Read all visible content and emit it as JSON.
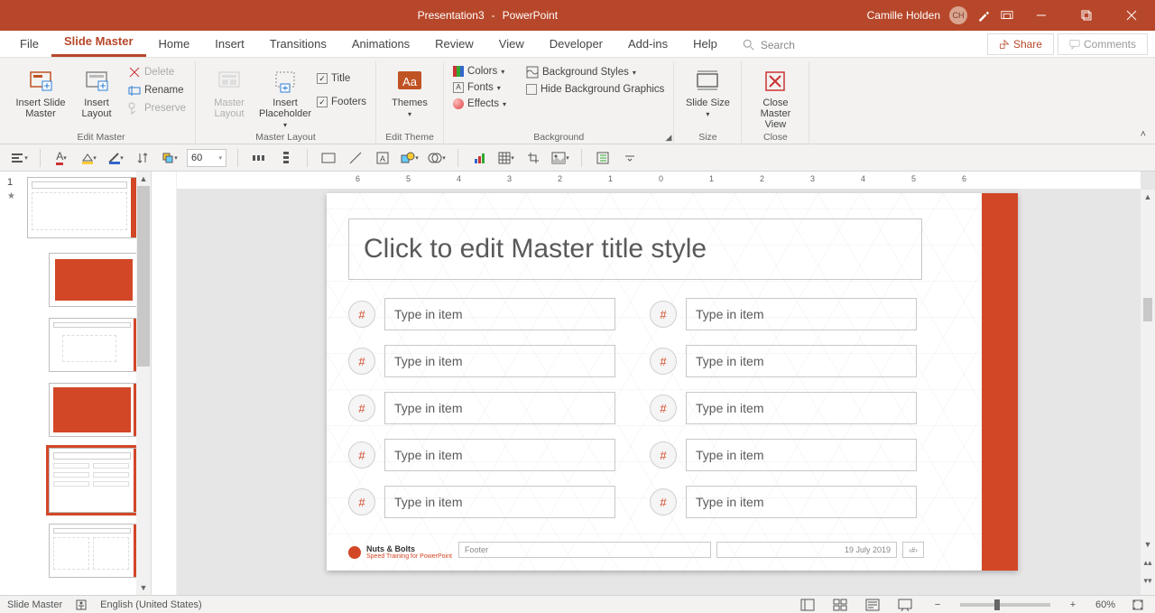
{
  "titlebar": {
    "doc": "Presentation3",
    "sep": "-",
    "app": "PowerPoint",
    "user": "Camille Holden",
    "initials": "CH"
  },
  "tabs": {
    "file": "File",
    "slide_master": "Slide Master",
    "home": "Home",
    "insert": "Insert",
    "transitions": "Transitions",
    "animations": "Animations",
    "review": "Review",
    "view": "View",
    "developer": "Developer",
    "addins": "Add-ins",
    "help": "Help",
    "search": "Search",
    "share": "Share",
    "comments": "Comments"
  },
  "ribbon": {
    "edit_master": {
      "insert_slide_master": "Insert Slide Master",
      "insert_layout": "Insert Layout",
      "delete": "Delete",
      "rename": "Rename",
      "preserve": "Preserve",
      "group": "Edit Master"
    },
    "master_layout": {
      "master_layout": "Master Layout",
      "insert_placeholder": "Insert Placeholder",
      "title_cb": "Title",
      "footers_cb": "Footers",
      "group": "Master Layout"
    },
    "edit_theme": {
      "themes": "Themes",
      "group": "Edit Theme"
    },
    "background": {
      "colors": "Colors",
      "fonts": "Fonts",
      "effects": "Effects",
      "bg_styles": "Background Styles",
      "hide_bg": "Hide Background Graphics",
      "group": "Background"
    },
    "size": {
      "slide_size": "Slide Size",
      "group": "Size"
    },
    "close": {
      "close_master": "Close Master View",
      "group": "Close"
    }
  },
  "qat": {
    "fontsize": "60"
  },
  "ruler": {
    "ticks": [
      "6",
      "5",
      "4",
      "3",
      "2",
      "1",
      "0",
      "1",
      "2",
      "3",
      "4",
      "5",
      "6"
    ]
  },
  "slide": {
    "title": "Click to edit Master title style",
    "num_ph": "#",
    "item_ph": "Type in item",
    "footer_ph": "Footer",
    "date": "19 July 2019",
    "logo1": "Nuts & Bolts",
    "logo2": "Speed Training for PowerPoint"
  },
  "thumbs": {
    "master_index": "1"
  },
  "status": {
    "mode": "Slide Master",
    "lang": "English (United States)",
    "zoom": "60%"
  },
  "colors": {
    "accent": "#D24726"
  }
}
